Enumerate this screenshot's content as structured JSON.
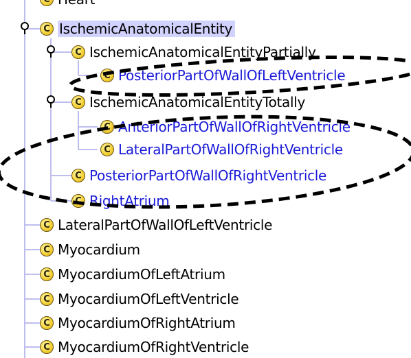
{
  "tree": {
    "nodes": [
      {
        "id": "top-partial",
        "label": "Heart",
        "type": "class",
        "inferred": false
      },
      {
        "id": "ischemic",
        "label": "IschemicAnatomicalEntity",
        "type": "class",
        "inferred": false,
        "selected": true
      },
      {
        "id": "ischemic-partially",
        "label": "IschemicAnatomicalEntityPartially",
        "type": "class",
        "inferred": false
      },
      {
        "id": "posterior-left",
        "label": "PosteriorPartOfWallOfLeftVentricle",
        "type": "class",
        "inferred": true
      },
      {
        "id": "ischemic-totally",
        "label": "IschemicAnatomicalEntityTotally",
        "type": "class",
        "inferred": false
      },
      {
        "id": "anterior-right",
        "label": "AnteriorPartOfWallOfRightVentricle",
        "type": "class",
        "inferred": true
      },
      {
        "id": "lateral-right",
        "label": "LateralPartOfWallOfRightVentricle",
        "type": "class",
        "inferred": true
      },
      {
        "id": "posterior-right",
        "label": "PosteriorPartOfWallOfRightVentricle",
        "type": "class",
        "inferred": true
      },
      {
        "id": "right-atrium",
        "label": "RightAtrium",
        "type": "class",
        "inferred": true
      },
      {
        "id": "lateral-left",
        "label": "LateralPartOfWallOfLeftVentricle",
        "type": "class",
        "inferred": false
      },
      {
        "id": "myocardium",
        "label": "Myocardium",
        "type": "class",
        "inferred": false
      },
      {
        "id": "myo-left-atrium",
        "label": "MyocardiumOfLeftAtrium",
        "type": "class",
        "inferred": false
      },
      {
        "id": "myo-left-ventricle",
        "label": "MyocardiumOfLeftVentricle",
        "type": "class",
        "inferred": false
      },
      {
        "id": "myo-right-atrium",
        "label": "MyocardiumOfRightAtrium",
        "type": "class",
        "inferred": false
      },
      {
        "id": "myo-right-ventricle",
        "label": "MyocardiumOfRightVentricle",
        "type": "class",
        "inferred": false
      }
    ],
    "class_badge_letter": "C",
    "icon_names": {
      "class": "class-icon",
      "expander": "expand-handle-icon"
    }
  },
  "colors": {
    "asserted_text": "#000000",
    "inferred_text": "#1a1ad8",
    "selection_bg": "#d2d2ff",
    "tree_line": "#a9a9e8",
    "class_badge": "#f4d23a",
    "annotation_ellipse": "#000000"
  }
}
